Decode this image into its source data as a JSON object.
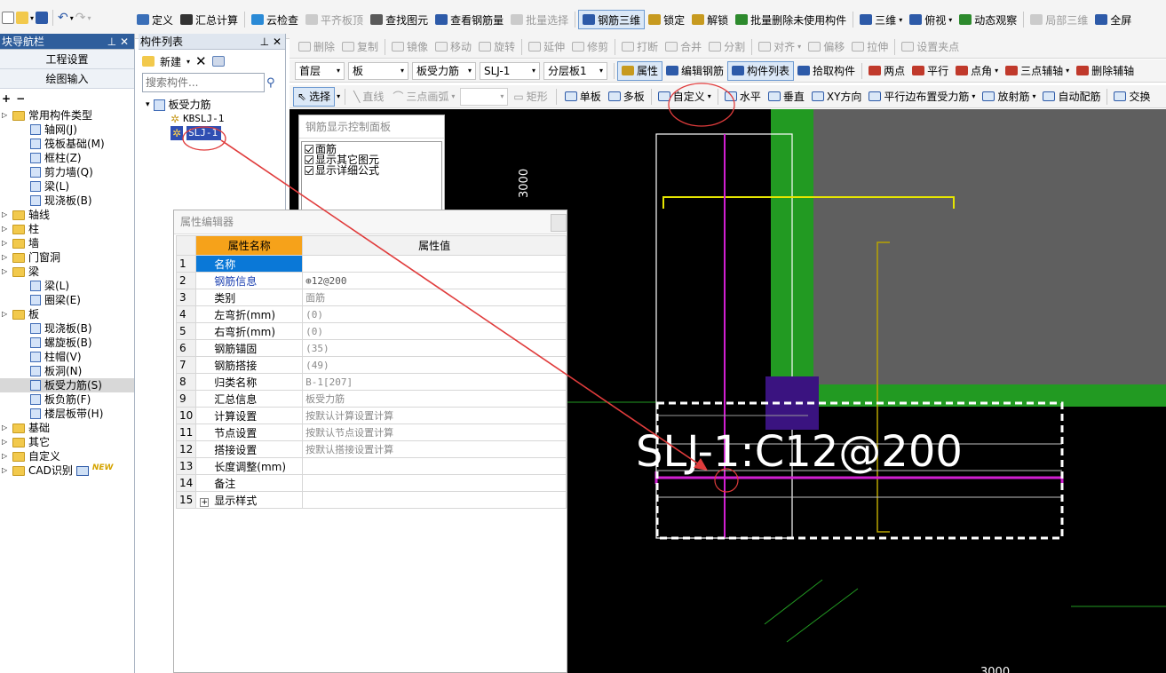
{
  "toolbar1": {
    "items": [
      {
        "label": "定义",
        "icon": "define-icon",
        "disabled": false
      },
      {
        "label": "汇总计算",
        "icon": "sigma-icon",
        "disabled": false
      },
      {
        "label": "云检查",
        "icon": "cloud-check-icon",
        "disabled": false
      },
      {
        "label": "平齐板顶",
        "icon": "align-top-icon",
        "disabled": true
      },
      {
        "label": "查找图元",
        "icon": "binoculars-icon",
        "disabled": false
      },
      {
        "label": "查看钢筋量",
        "icon": "view-rebar-icon",
        "disabled": false
      },
      {
        "label": "批量选择",
        "icon": "batch-select-icon",
        "disabled": true
      },
      {
        "label": "钢筋三维",
        "icon": "rebar-3d-icon",
        "disabled": false
      },
      {
        "label": "锁定",
        "icon": "lock-icon",
        "disabled": false
      },
      {
        "label": "解锁",
        "icon": "unlock-icon",
        "disabled": false
      },
      {
        "label": "批量删除未使用构件",
        "icon": "batch-delete-icon",
        "disabled": false
      },
      {
        "label": "三维",
        "icon": "cube-icon",
        "disabled": false
      },
      {
        "label": "俯视",
        "icon": "top-view-icon",
        "disabled": false
      },
      {
        "label": "动态观察",
        "icon": "orbit-icon",
        "disabled": false
      },
      {
        "label": "局部三维",
        "icon": "local-3d-icon",
        "disabled": true
      },
      {
        "label": "全屏",
        "icon": "fullscreen-icon",
        "disabled": false
      }
    ]
  },
  "toolbar2": {
    "items": [
      "删除",
      "复制",
      "镜像",
      "移动",
      "旋转",
      "延伸",
      "修剪",
      "打断",
      "合并",
      "分割",
      "对齐",
      "偏移",
      "拉伸",
      "设置夹点"
    ]
  },
  "toolbar3": {
    "floor": "首层",
    "type": "板",
    "category": "板受力筋",
    "member": "SLJ-1",
    "layer": "分层板1",
    "items": [
      "属性",
      "编辑钢筋",
      "构件列表",
      "拾取构件",
      "两点",
      "平行",
      "点角",
      "三点辅轴",
      "删除辅轴"
    ]
  },
  "toolbar4": {
    "select": "选择",
    "draw": [
      "直线",
      "三点画弧",
      "矩形"
    ],
    "items": [
      "单板",
      "多板",
      "自定义",
      "水平",
      "垂直",
      "XY方向",
      "平行边布置受力筋",
      "放射筋",
      "自动配筋",
      "交换"
    ]
  },
  "leftnav": {
    "title": "块导航栏",
    "buttons": [
      "工程设置",
      "绘图输入"
    ],
    "tree": [
      {
        "label": "常用构件类型",
        "level": 0,
        "kind": "folder"
      },
      {
        "label": "轴网(J)",
        "level": 1,
        "kind": "item"
      },
      {
        "label": "筏板基础(M)",
        "level": 1,
        "kind": "item"
      },
      {
        "label": "框柱(Z)",
        "level": 1,
        "kind": "item"
      },
      {
        "label": "剪力墙(Q)",
        "level": 1,
        "kind": "item"
      },
      {
        "label": "梁(L)",
        "level": 1,
        "kind": "item"
      },
      {
        "label": "现浇板(B)",
        "level": 1,
        "kind": "item"
      },
      {
        "label": "轴线",
        "level": 0,
        "kind": "folder"
      },
      {
        "label": "柱",
        "level": 0,
        "kind": "folder"
      },
      {
        "label": "墙",
        "level": 0,
        "kind": "folder"
      },
      {
        "label": "门窗洞",
        "level": 0,
        "kind": "folder"
      },
      {
        "label": "梁",
        "level": 0,
        "kind": "folder"
      },
      {
        "label": "梁(L)",
        "level": 1,
        "kind": "item"
      },
      {
        "label": "圈梁(E)",
        "level": 1,
        "kind": "item"
      },
      {
        "label": "板",
        "level": 0,
        "kind": "folder"
      },
      {
        "label": "现浇板(B)",
        "level": 1,
        "kind": "item"
      },
      {
        "label": "螺旋板(B)",
        "level": 1,
        "kind": "item"
      },
      {
        "label": "柱帽(V)",
        "level": 1,
        "kind": "item"
      },
      {
        "label": "板洞(N)",
        "level": 1,
        "kind": "item"
      },
      {
        "label": "板受力筋(S)",
        "level": 1,
        "kind": "item",
        "selected": true
      },
      {
        "label": "板负筋(F)",
        "level": 1,
        "kind": "item"
      },
      {
        "label": "楼层板带(H)",
        "level": 1,
        "kind": "item"
      },
      {
        "label": "基础",
        "level": 0,
        "kind": "folder"
      },
      {
        "label": "其它",
        "level": 0,
        "kind": "folder"
      },
      {
        "label": "自定义",
        "level": 0,
        "kind": "folder"
      },
      {
        "label": "CAD识别",
        "level": 0,
        "kind": "folder",
        "badge": "NEW"
      }
    ]
  },
  "complist": {
    "title": "构件列表",
    "new_label": "新建",
    "search_placeholder": "搜索构件...",
    "root": "板受力筋",
    "children": [
      "KBSLJ-1",
      "SLJ-1"
    ],
    "selected": "SLJ-1"
  },
  "rebar_panel": {
    "title": "钢筋显示控制面板",
    "options": [
      "面筋",
      "显示其它图元",
      "显示详细公式"
    ]
  },
  "prop_editor": {
    "title": "属性编辑器",
    "col_name": "属性名称",
    "col_value": "属性值",
    "rows": [
      {
        "num": "1",
        "name": "名称",
        "value": "",
        "selected": true
      },
      {
        "num": "2",
        "name": "钢筋信息",
        "value": "⊕12@200",
        "link": true
      },
      {
        "num": "3",
        "name": "类别",
        "value": "面筋"
      },
      {
        "num": "4",
        "name": "左弯折(mm)",
        "value": "(0)"
      },
      {
        "num": "5",
        "name": "右弯折(mm)",
        "value": "(0)"
      },
      {
        "num": "6",
        "name": "钢筋锚固",
        "value": "(35)"
      },
      {
        "num": "7",
        "name": "钢筋搭接",
        "value": "(49)"
      },
      {
        "num": "8",
        "name": "归类名称",
        "value": "B-1[207]"
      },
      {
        "num": "9",
        "name": "汇总信息",
        "value": "板受力筋"
      },
      {
        "num": "10",
        "name": "计算设置",
        "value": "按默认计算设置计算"
      },
      {
        "num": "11",
        "name": "节点设置",
        "value": "按默认节点设置计算"
      },
      {
        "num": "12",
        "name": "搭接设置",
        "value": "按默认搭接设置计算"
      },
      {
        "num": "13",
        "name": "长度调整(mm)",
        "value": ""
      },
      {
        "num": "14",
        "name": "备注",
        "value": ""
      },
      {
        "num": "15",
        "name": "显示样式",
        "value": "",
        "expandable": true
      }
    ]
  },
  "canvas": {
    "rebar_label": "SLJ-1:C12@200",
    "dim_top": "3000",
    "dim_bottom": "3000",
    "colors": {
      "bg": "#000000",
      "beam": "#229a22",
      "slab": "#5f5f5f",
      "rebar": "#d21fd2",
      "column": "#3a1380",
      "annotation": "#e03c3c"
    }
  }
}
